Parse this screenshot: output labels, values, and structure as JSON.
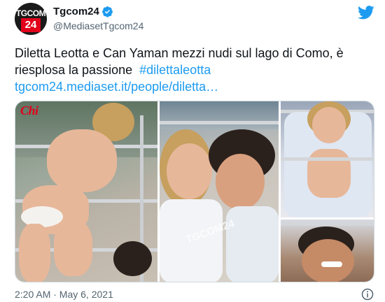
{
  "tweet": {
    "avatar": {
      "logo_top": "TGCOM",
      "logo_number": "24"
    },
    "display_name": "Tgcom24",
    "handle": "@MediasetTgcom24",
    "text": "Diletta Leotta e Can Yaman mezzi nudi sul lago di Como, è riesplosa la passione",
    "hashtag": "#dilettaleotta",
    "link": "tgcom24.mediaset.it/people/diletta…",
    "timestamp": "2:20 AM · May 6, 2021",
    "media": {
      "photo_count": 4,
      "watermark_chi": "Chi",
      "watermark_tgcom": "TGCOM24"
    }
  },
  "icons": {
    "verified": "verified-badge-icon",
    "twitter": "twitter-bird-icon",
    "info": "info-icon"
  },
  "colors": {
    "accent": "#1d9bf0",
    "text": "#0f1419",
    "secondary": "#536471",
    "brand_red": "#e2001a"
  }
}
